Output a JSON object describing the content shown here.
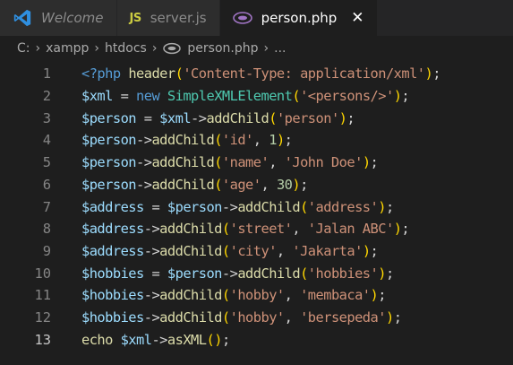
{
  "tabs": [
    {
      "label": "Welcome",
      "icon": "vscode-icon"
    },
    {
      "label": "server.js",
      "icon": "js-icon",
      "icon_text": "JS"
    },
    {
      "label": "person.php",
      "icon": "php-icon",
      "close": "✕"
    }
  ],
  "breadcrumb": {
    "items": [
      "C:",
      "xampp",
      "htdocs",
      "person.php",
      "..."
    ],
    "separator": "›"
  },
  "editor": {
    "active_line": 13,
    "lines": [
      {
        "n": "1",
        "tokens": [
          [
            "tag",
            "<?php"
          ],
          [
            "plain",
            " "
          ],
          [
            "fn",
            "header"
          ],
          [
            "br1",
            "("
          ],
          [
            "str",
            "'Content-Type: application/xml'"
          ],
          [
            "br1",
            ")"
          ],
          [
            "plain",
            ";"
          ]
        ]
      },
      {
        "n": "2",
        "tokens": [
          [
            "var",
            "$xml"
          ],
          [
            "op",
            " = "
          ],
          [
            "kw",
            "new"
          ],
          [
            "plain",
            " "
          ],
          [
            "cls",
            "SimpleXMLElement"
          ],
          [
            "br1",
            "("
          ],
          [
            "str",
            "'<persons/>'"
          ],
          [
            "br1",
            ")"
          ],
          [
            "plain",
            ";"
          ]
        ]
      },
      {
        "n": "3",
        "tokens": [
          [
            "var",
            "$person"
          ],
          [
            "op",
            " = "
          ],
          [
            "var",
            "$xml"
          ],
          [
            "op",
            "->"
          ],
          [
            "fn",
            "addChild"
          ],
          [
            "br1",
            "("
          ],
          [
            "str",
            "'person'"
          ],
          [
            "br1",
            ")"
          ],
          [
            "plain",
            ";"
          ]
        ]
      },
      {
        "n": "4",
        "tokens": [
          [
            "var",
            "$person"
          ],
          [
            "op",
            "->"
          ],
          [
            "fn",
            "addChild"
          ],
          [
            "br1",
            "("
          ],
          [
            "str",
            "'id'"
          ],
          [
            "plain",
            ", "
          ],
          [
            "num",
            "1"
          ],
          [
            "br1",
            ")"
          ],
          [
            "plain",
            ";"
          ]
        ]
      },
      {
        "n": "5",
        "tokens": [
          [
            "var",
            "$person"
          ],
          [
            "op",
            "->"
          ],
          [
            "fn",
            "addChild"
          ],
          [
            "br1",
            "("
          ],
          [
            "str",
            "'name'"
          ],
          [
            "plain",
            ", "
          ],
          [
            "str",
            "'John Doe'"
          ],
          [
            "br1",
            ")"
          ],
          [
            "plain",
            ";"
          ]
        ]
      },
      {
        "n": "6",
        "tokens": [
          [
            "var",
            "$person"
          ],
          [
            "op",
            "->"
          ],
          [
            "fn",
            "addChild"
          ],
          [
            "br1",
            "("
          ],
          [
            "str",
            "'age'"
          ],
          [
            "plain",
            ", "
          ],
          [
            "num",
            "30"
          ],
          [
            "br1",
            ")"
          ],
          [
            "plain",
            ";"
          ]
        ]
      },
      {
        "n": "7",
        "tokens": [
          [
            "var",
            "$address"
          ],
          [
            "op",
            " = "
          ],
          [
            "var",
            "$person"
          ],
          [
            "op",
            "->"
          ],
          [
            "fn",
            "addChild"
          ],
          [
            "br1",
            "("
          ],
          [
            "str",
            "'address'"
          ],
          [
            "br1",
            ")"
          ],
          [
            "plain",
            ";"
          ]
        ]
      },
      {
        "n": "8",
        "tokens": [
          [
            "var",
            "$address"
          ],
          [
            "op",
            "->"
          ],
          [
            "fn",
            "addChild"
          ],
          [
            "br1",
            "("
          ],
          [
            "str",
            "'street'"
          ],
          [
            "plain",
            ", "
          ],
          [
            "str",
            "'Jalan ABC'"
          ],
          [
            "br1",
            ")"
          ],
          [
            "plain",
            ";"
          ]
        ]
      },
      {
        "n": "9",
        "tokens": [
          [
            "var",
            "$address"
          ],
          [
            "op",
            "->"
          ],
          [
            "fn",
            "addChild"
          ],
          [
            "br1",
            "("
          ],
          [
            "str",
            "'city'"
          ],
          [
            "plain",
            ", "
          ],
          [
            "str",
            "'Jakarta'"
          ],
          [
            "br1",
            ")"
          ],
          [
            "plain",
            ";"
          ]
        ]
      },
      {
        "n": "10",
        "tokens": [
          [
            "var",
            "$hobbies"
          ],
          [
            "op",
            " = "
          ],
          [
            "var",
            "$person"
          ],
          [
            "op",
            "->"
          ],
          [
            "fn",
            "addChild"
          ],
          [
            "br1",
            "("
          ],
          [
            "str",
            "'hobbies'"
          ],
          [
            "br1",
            ")"
          ],
          [
            "plain",
            ";"
          ]
        ]
      },
      {
        "n": "11",
        "tokens": [
          [
            "var",
            "$hobbies"
          ],
          [
            "op",
            "->"
          ],
          [
            "fn",
            "addChild"
          ],
          [
            "br1",
            "("
          ],
          [
            "str",
            "'hobby'"
          ],
          [
            "plain",
            ", "
          ],
          [
            "str",
            "'membaca'"
          ],
          [
            "br1",
            ")"
          ],
          [
            "plain",
            ";"
          ]
        ]
      },
      {
        "n": "12",
        "tokens": [
          [
            "var",
            "$hobbies"
          ],
          [
            "op",
            "->"
          ],
          [
            "fn",
            "addChild"
          ],
          [
            "br1",
            "("
          ],
          [
            "str",
            "'hobby'"
          ],
          [
            "plain",
            ", "
          ],
          [
            "str",
            "'bersepeda'"
          ],
          [
            "br1",
            ")"
          ],
          [
            "plain",
            ";"
          ]
        ]
      },
      {
        "n": "13",
        "tokens": [
          [
            "fn",
            "echo"
          ],
          [
            "plain",
            " "
          ],
          [
            "var",
            "$xml"
          ],
          [
            "op",
            "->"
          ],
          [
            "fn",
            "asXML"
          ],
          [
            "br1",
            "("
          ],
          [
            "br1",
            ")"
          ],
          [
            "plain",
            ";"
          ]
        ]
      }
    ]
  }
}
